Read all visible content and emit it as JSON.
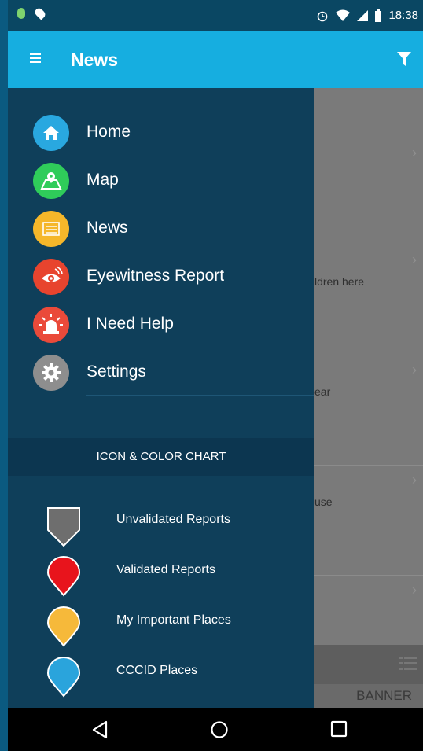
{
  "status_bar": {
    "time": "18:38",
    "icons": [
      "notification-dot-icon",
      "location-pin-icon",
      "alarm-icon",
      "wifi-icon",
      "signal-icon",
      "battery-icon"
    ]
  },
  "app_bar": {
    "title": "News",
    "menu_icon": "hamburger-menu-icon",
    "filter_icon": "filter-icon"
  },
  "drawer": {
    "items": [
      {
        "label": "Home",
        "icon": "home-icon",
        "color": "#29a8e0"
      },
      {
        "label": "Map",
        "icon": "map-icon",
        "color": "#2fcc5a"
      },
      {
        "label": "News",
        "icon": "news-icon",
        "color": "#f5b72a"
      },
      {
        "label": "Eyewitness Report",
        "icon": "eye-icon",
        "color": "#e8442e"
      },
      {
        "label": "I Need Help",
        "icon": "siren-icon",
        "color": "#ea4a3a"
      },
      {
        "label": "Settings",
        "icon": "gear-icon",
        "color": "#8e8e8e"
      }
    ],
    "chart_title": "ICON & COLOR CHART",
    "legend": [
      {
        "label": "Unvalidated Reports",
        "color": "#6e6e6e",
        "shape": "shield"
      },
      {
        "label": "Validated Reports",
        "color": "#e8141c",
        "shape": "pin"
      },
      {
        "label": "My Important Places",
        "color": "#f6b93a",
        "shape": "pin"
      },
      {
        "label": "CCCID Places",
        "color": "#2aa4dc",
        "shape": "pin"
      }
    ]
  },
  "background_content": {
    "rows": [
      {
        "text": ""
      },
      {
        "text": "ldren here"
      },
      {
        "text": "ear"
      },
      {
        "text": "use"
      },
      {
        "text": ""
      }
    ],
    "banner": "BANNER"
  },
  "nav_bar": {
    "buttons": [
      "back-icon",
      "home-circle-icon",
      "recents-icon"
    ]
  }
}
